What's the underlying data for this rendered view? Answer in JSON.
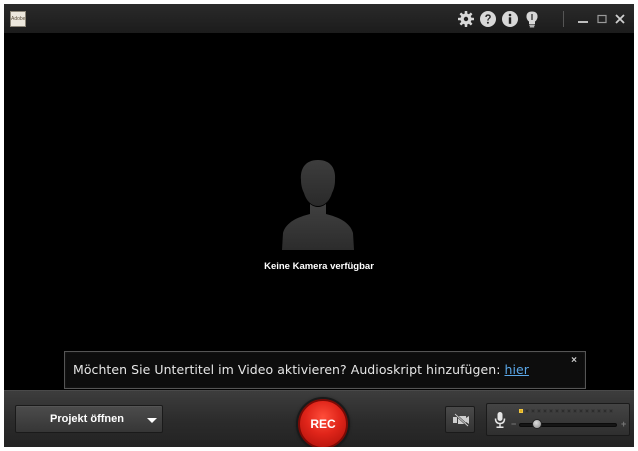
{
  "window": {
    "app_logo_text": "Adobe",
    "title_icons": [
      "gear-icon",
      "help-icon",
      "info-icon",
      "lightbulb-icon"
    ],
    "window_controls": [
      "minimize-icon",
      "maximize-icon",
      "close-icon"
    ]
  },
  "stage": {
    "status_text": "Keine Kamera verfügbar",
    "placeholder_icon": "person-silhouette-icon"
  },
  "notice": {
    "message": "Möchten Sie Untertitel im Video aktivieren? Audioskript hinzufügen:",
    "link_text": "hier",
    "close_glyph": "×"
  },
  "toolbar": {
    "project_button_label": "Projekt öffnen",
    "record_button_label": "REC",
    "record_color": "#e0251a",
    "accent_link_color": "#5aa7e8",
    "audio": {
      "minus_glyph": "−",
      "plus_glyph": "+",
      "volume_level": 0.15,
      "input_level": 0.05
    }
  }
}
